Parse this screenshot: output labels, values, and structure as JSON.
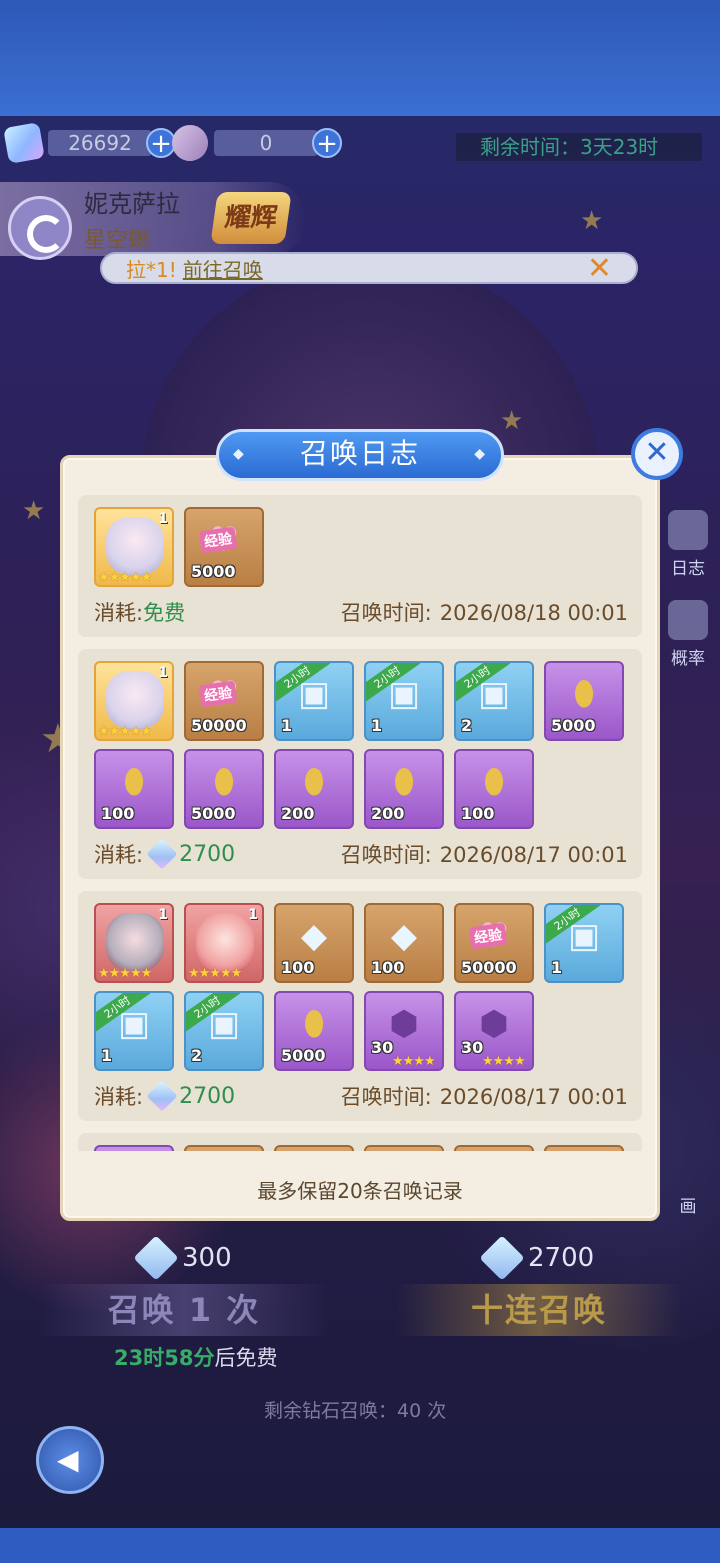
{
  "resources": [
    {
      "name": "crystal",
      "value": "26692",
      "icon": "crystal-icon"
    },
    {
      "name": "ticket",
      "value": "0",
      "icon": "ticket-icon"
    }
  ],
  "timer": "剩余时间：3天23时",
  "hero": {
    "name": "妮克萨拉",
    "title": "星空蝎",
    "badge": "耀辉"
  },
  "notice": {
    "prefix": "拉*1!",
    "link": "前往召唤",
    "close": "✕"
  },
  "side_buttons": [
    {
      "label": "日志"
    },
    {
      "label": "概率"
    },
    {
      "label": "画"
    }
  ],
  "dialog": {
    "title": "召唤日志",
    "footer": "最多保留20条召唤记录",
    "cost_label": "消耗:",
    "time_label": "召唤时间:",
    "logs": [
      {
        "cost_type": "free",
        "cost": "免费",
        "time": "2026/08/18 00:01",
        "items": [
          {
            "kind": "hero",
            "color": "gold",
            "face": "white",
            "level": "1",
            "stars": "★★★★★"
          },
          {
            "kind": "exp-heart",
            "color": "bronze",
            "qty": "5000"
          }
        ]
      },
      {
        "cost_type": "gem",
        "cost": "2700",
        "time": "2026/08/17 00:01",
        "items": [
          {
            "kind": "hero",
            "color": "gold",
            "face": "white",
            "level": "1",
            "stars": "★★★★★"
          },
          {
            "kind": "exp-heart",
            "color": "bronze",
            "qty": "50000"
          },
          {
            "kind": "chest",
            "color": "blue",
            "qty": "1",
            "ribbon": "2小时"
          },
          {
            "kind": "chest",
            "color": "blue",
            "qty": "1",
            "ribbon": "2小时"
          },
          {
            "kind": "chest",
            "color": "blue",
            "qty": "2",
            "ribbon": "2小时"
          },
          {
            "kind": "egg",
            "color": "purple",
            "qty": "5000"
          },
          {
            "kind": "egg",
            "color": "purple",
            "qty": "100"
          },
          {
            "kind": "egg",
            "color": "purple",
            "qty": "5000"
          },
          {
            "kind": "egg",
            "color": "purple",
            "qty": "200"
          },
          {
            "kind": "egg",
            "color": "purple",
            "qty": "200"
          },
          {
            "kind": "egg",
            "color": "purple",
            "qty": "100"
          }
        ]
      },
      {
        "cost_type": "gem",
        "cost": "2700",
        "time": "2026/08/17 00:01",
        "items": [
          {
            "kind": "hero",
            "color": "red",
            "face": "red",
            "level": "1",
            "stars": "★★★★★"
          },
          {
            "kind": "hero",
            "color": "red",
            "face": "pink",
            "level": "1",
            "stars": "★★★★★"
          },
          {
            "kind": "crystal",
            "color": "bronze",
            "qty": "100"
          },
          {
            "kind": "crystal",
            "color": "bronze",
            "qty": "100"
          },
          {
            "kind": "exp-heart",
            "color": "bronze",
            "qty": "50000"
          },
          {
            "kind": "chest",
            "color": "blue",
            "qty": "1",
            "ribbon": "2小时"
          },
          {
            "kind": "chest",
            "color": "blue",
            "qty": "1",
            "ribbon": "2小时"
          },
          {
            "kind": "chest",
            "color": "blue",
            "qty": "2",
            "ribbon": "2小时"
          },
          {
            "kind": "egg",
            "color": "purple",
            "qty": "5000"
          },
          {
            "kind": "amethyst",
            "color": "purple",
            "qty": "30",
            "stars": "★★★★"
          },
          {
            "kind": "amethyst",
            "color": "purple",
            "qty": "30",
            "stars": "★★★★"
          }
        ]
      },
      {
        "cost_type": "partial",
        "items": [
          {
            "kind": "orb",
            "color": "purple"
          },
          {
            "kind": "crystal",
            "color": "bronze"
          },
          {
            "kind": "crystal",
            "color": "bronze"
          },
          {
            "kind": "crystal",
            "color": "bronze"
          },
          {
            "kind": "crystal",
            "color": "bronze"
          },
          {
            "kind": "crystal",
            "color": "bronze"
          }
        ]
      }
    ]
  },
  "summon": {
    "single_cost": "300",
    "ten_cost": "2700",
    "single_label": "召唤 1 次",
    "ten_label": "十连召唤",
    "free_countdown": "23时58分",
    "free_suffix": "后免费",
    "remaining": "剩余钻石召唤：40 次"
  },
  "exp_label": "经验"
}
